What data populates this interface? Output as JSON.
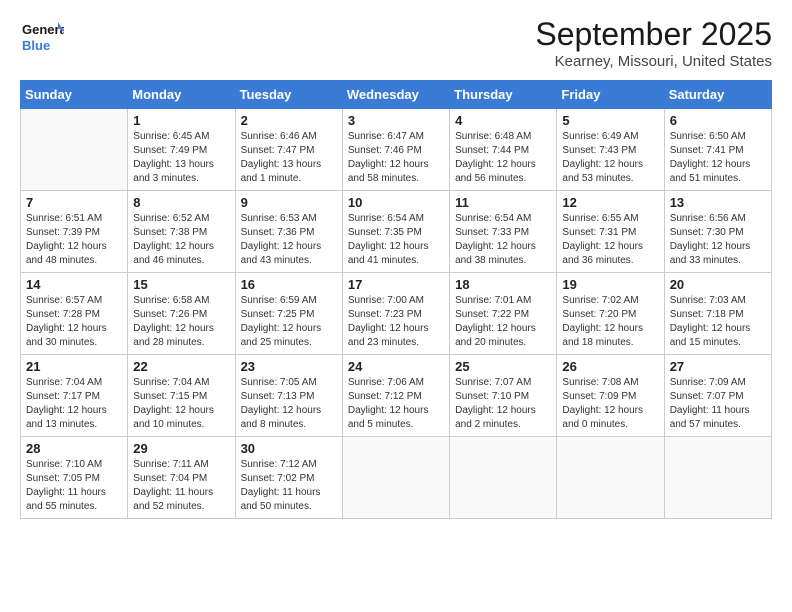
{
  "header": {
    "logo_line1": "General",
    "logo_line2": "Blue",
    "month_title": "September 2025",
    "location": "Kearney, Missouri, United States"
  },
  "weekdays": [
    "Sunday",
    "Monday",
    "Tuesday",
    "Wednesday",
    "Thursday",
    "Friday",
    "Saturday"
  ],
  "weeks": [
    [
      {
        "num": "",
        "empty": true
      },
      {
        "num": "1",
        "rise": "6:45 AM",
        "set": "7:49 PM",
        "daylight": "13 hours and 3 minutes."
      },
      {
        "num": "2",
        "rise": "6:46 AM",
        "set": "7:47 PM",
        "daylight": "13 hours and 1 minute."
      },
      {
        "num": "3",
        "rise": "6:47 AM",
        "set": "7:46 PM",
        "daylight": "12 hours and 58 minutes."
      },
      {
        "num": "4",
        "rise": "6:48 AM",
        "set": "7:44 PM",
        "daylight": "12 hours and 56 minutes."
      },
      {
        "num": "5",
        "rise": "6:49 AM",
        "set": "7:43 PM",
        "daylight": "12 hours and 53 minutes."
      },
      {
        "num": "6",
        "rise": "6:50 AM",
        "set": "7:41 PM",
        "daylight": "12 hours and 51 minutes."
      }
    ],
    [
      {
        "num": "7",
        "rise": "6:51 AM",
        "set": "7:39 PM",
        "daylight": "12 hours and 48 minutes."
      },
      {
        "num": "8",
        "rise": "6:52 AM",
        "set": "7:38 PM",
        "daylight": "12 hours and 46 minutes."
      },
      {
        "num": "9",
        "rise": "6:53 AM",
        "set": "7:36 PM",
        "daylight": "12 hours and 43 minutes."
      },
      {
        "num": "10",
        "rise": "6:54 AM",
        "set": "7:35 PM",
        "daylight": "12 hours and 41 minutes."
      },
      {
        "num": "11",
        "rise": "6:54 AM",
        "set": "7:33 PM",
        "daylight": "12 hours and 38 minutes."
      },
      {
        "num": "12",
        "rise": "6:55 AM",
        "set": "7:31 PM",
        "daylight": "12 hours and 36 minutes."
      },
      {
        "num": "13",
        "rise": "6:56 AM",
        "set": "7:30 PM",
        "daylight": "12 hours and 33 minutes."
      }
    ],
    [
      {
        "num": "14",
        "rise": "6:57 AM",
        "set": "7:28 PM",
        "daylight": "12 hours and 30 minutes."
      },
      {
        "num": "15",
        "rise": "6:58 AM",
        "set": "7:26 PM",
        "daylight": "12 hours and 28 minutes."
      },
      {
        "num": "16",
        "rise": "6:59 AM",
        "set": "7:25 PM",
        "daylight": "12 hours and 25 minutes."
      },
      {
        "num": "17",
        "rise": "7:00 AM",
        "set": "7:23 PM",
        "daylight": "12 hours and 23 minutes."
      },
      {
        "num": "18",
        "rise": "7:01 AM",
        "set": "7:22 PM",
        "daylight": "12 hours and 20 minutes."
      },
      {
        "num": "19",
        "rise": "7:02 AM",
        "set": "7:20 PM",
        "daylight": "12 hours and 18 minutes."
      },
      {
        "num": "20",
        "rise": "7:03 AM",
        "set": "7:18 PM",
        "daylight": "12 hours and 15 minutes."
      }
    ],
    [
      {
        "num": "21",
        "rise": "7:04 AM",
        "set": "7:17 PM",
        "daylight": "12 hours and 13 minutes."
      },
      {
        "num": "22",
        "rise": "7:04 AM",
        "set": "7:15 PM",
        "daylight": "12 hours and 10 minutes."
      },
      {
        "num": "23",
        "rise": "7:05 AM",
        "set": "7:13 PM",
        "daylight": "12 hours and 8 minutes."
      },
      {
        "num": "24",
        "rise": "7:06 AM",
        "set": "7:12 PM",
        "daylight": "12 hours and 5 minutes."
      },
      {
        "num": "25",
        "rise": "7:07 AM",
        "set": "7:10 PM",
        "daylight": "12 hours and 2 minutes."
      },
      {
        "num": "26",
        "rise": "7:08 AM",
        "set": "7:09 PM",
        "daylight": "12 hours and 0 minutes."
      },
      {
        "num": "27",
        "rise": "7:09 AM",
        "set": "7:07 PM",
        "daylight": "11 hours and 57 minutes."
      }
    ],
    [
      {
        "num": "28",
        "rise": "7:10 AM",
        "set": "7:05 PM",
        "daylight": "11 hours and 55 minutes."
      },
      {
        "num": "29",
        "rise": "7:11 AM",
        "set": "7:04 PM",
        "daylight": "11 hours and 52 minutes."
      },
      {
        "num": "30",
        "rise": "7:12 AM",
        "set": "7:02 PM",
        "daylight": "11 hours and 50 minutes."
      },
      {
        "num": "",
        "empty": true
      },
      {
        "num": "",
        "empty": true
      },
      {
        "num": "",
        "empty": true
      },
      {
        "num": "",
        "empty": true
      }
    ]
  ]
}
